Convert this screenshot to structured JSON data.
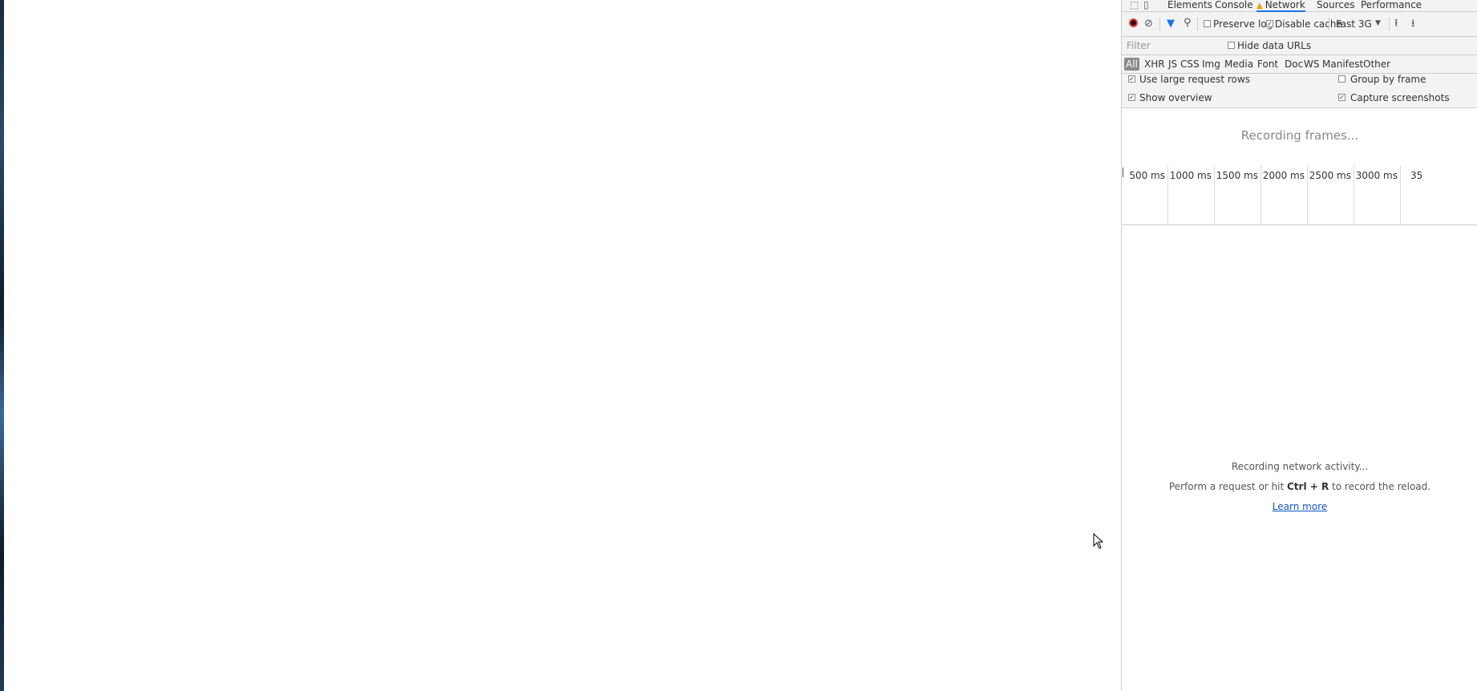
{
  "tabs": {
    "inspect_icon": "inspect-element-icon",
    "device_icon": "device-toolbar-icon",
    "elements": "Elements",
    "console": "Console",
    "network": "Network",
    "sources": "Sources",
    "performance": "Performance",
    "network_warning_icon": "warning-icon"
  },
  "toolbar": {
    "preserve_log": "Preserve log",
    "disable_cache": "Disable cache",
    "throttle": "Fast 3G",
    "preserve_log_checked": false,
    "disable_cache_checked": true
  },
  "filter": {
    "placeholder": "Filter",
    "hide_data_urls": "Hide data URLs",
    "types": [
      "All",
      "XHR",
      "JS",
      "CSS",
      "Img",
      "Media",
      "Font",
      "Doc",
      "WS",
      "Manifest",
      "Other"
    ],
    "active_type": "All"
  },
  "settings": {
    "use_large_rows": "Use large request rows",
    "group_by_frame": "Group by frame",
    "show_overview": "Show overview",
    "capture_screenshots": "Capture screenshots"
  },
  "overview": {
    "recording_frames": "Recording frames...",
    "ticks": [
      "500 ms",
      "1000 ms",
      "1500 ms",
      "2000 ms",
      "2500 ms",
      "3000 ms",
      "35"
    ]
  },
  "empty_state": {
    "line1": "Recording network activity...",
    "line2_prefix": "Perform a request or hit ",
    "shortcut": "Ctrl + R",
    "line2_suffix": " to record the reload.",
    "learn_more": "Learn more"
  },
  "colors": {
    "active_tab_underline": "#1a73e8",
    "record_red": "#d44444",
    "link": "#1155cc"
  }
}
